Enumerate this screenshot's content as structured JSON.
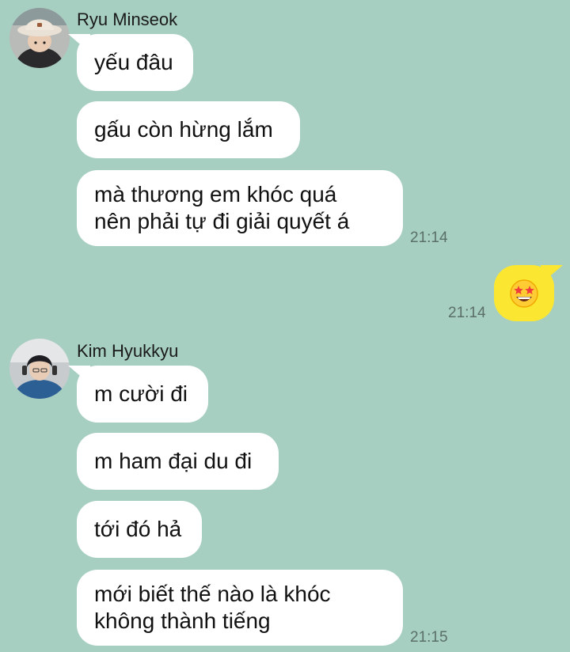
{
  "colors": {
    "background": "#a6cec1",
    "incoming_bubble": "#ffffff",
    "outgoing_bubble": "#fbe731",
    "timestamp": "#5b6f69"
  },
  "conversation": [
    {
      "sender": "Ryu Minseok",
      "avatar_icon": "user-avatar-bucket-hat",
      "messages": [
        "yếu đâu",
        "gấu còn hừng lắm",
        "mà thương em khóc quá\nnên phải tự đi giải quyết á"
      ],
      "time": "21:14"
    },
    {
      "sender": "me",
      "sticker_icon": "star-struck-emoji",
      "time": "21:14"
    },
    {
      "sender": "Kim Hyukkyu",
      "avatar_icon": "user-avatar-headset",
      "messages": [
        "m cười đi",
        "m ham đại du đi",
        "tới đó hả",
        "mới biết thế nào là khóc\nkhông thành tiếng"
      ],
      "time": "21:15"
    }
  ]
}
